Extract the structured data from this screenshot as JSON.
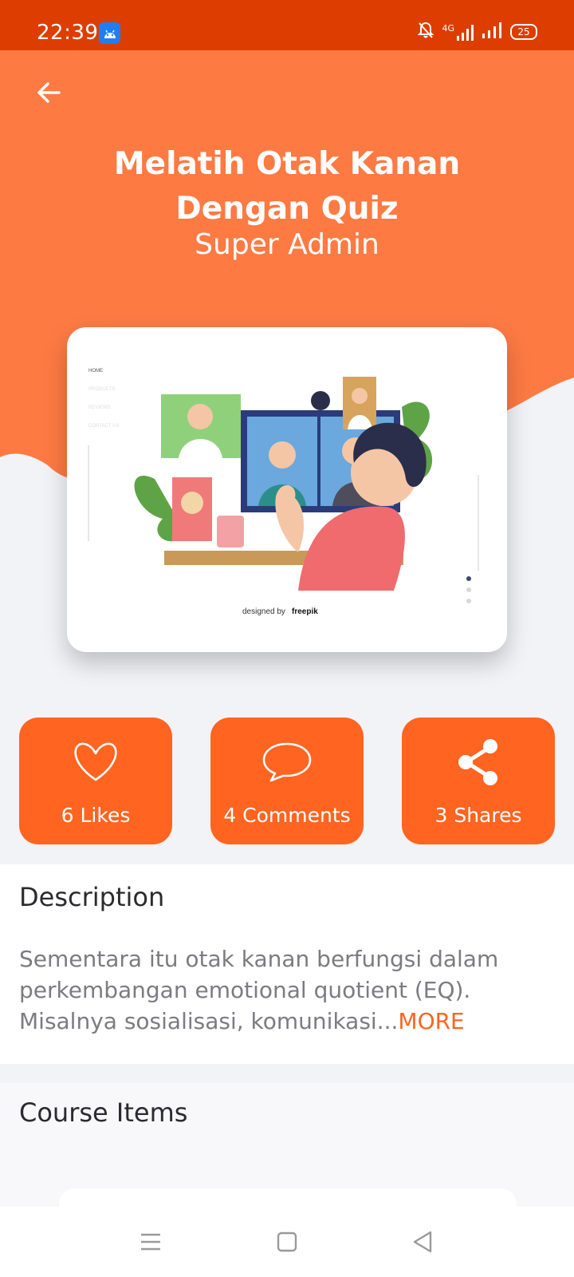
{
  "status_bar": {
    "time": "22:39",
    "network": "4G",
    "battery": "25",
    "icons": [
      "android-app-icon",
      "notifications-off-icon",
      "signal-icon",
      "battery-icon"
    ]
  },
  "header": {
    "title": "Melatih Otak Kanan Dengan Quiz",
    "author": "Super Admin",
    "back_icon": "arrow-left-icon"
  },
  "hero_image": {
    "nav_items": [
      "HOME",
      "PRODUCTS",
      "REVIEWS",
      "CONTACT US"
    ],
    "credit": "designed by",
    "credit_brand": "freepik"
  },
  "stats": {
    "likes": {
      "label": "6 Likes",
      "icon": "heart-icon"
    },
    "comments": {
      "label": "4 Comments",
      "icon": "chat-bubble-icon"
    },
    "shares": {
      "label": "3 Shares",
      "icon": "share-icon"
    }
  },
  "description": {
    "heading": "Description",
    "text": "Sementara itu otak kanan berfungsi dalam perkembangan emotional quotient (EQ). Misalnya sosialisasi, komunikasi...",
    "more_label": "MORE"
  },
  "course_items": {
    "heading": "Course Items"
  },
  "colors": {
    "accent": "#ff6420",
    "header": "#fd7a43",
    "status_bar": "#dd3e00",
    "background": "#f2f3f7"
  }
}
